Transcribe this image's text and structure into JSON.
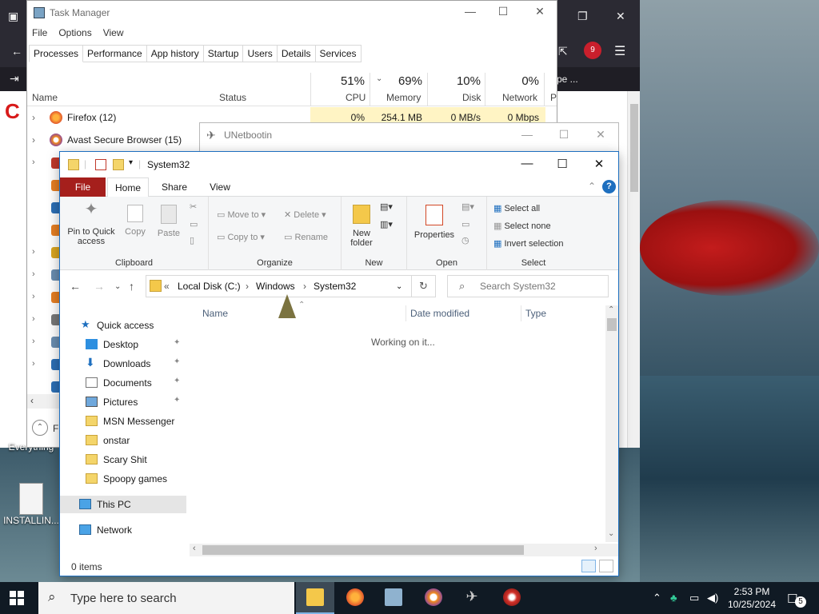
{
  "task_manager": {
    "title": "Task Manager",
    "menu": [
      "File",
      "Options",
      "View"
    ],
    "tabs": [
      "Processes",
      "Performance",
      "App history",
      "Startup",
      "Users",
      "Details",
      "Services"
    ],
    "columns": {
      "name": "Name",
      "status": "Status",
      "cpu": "CPU",
      "memory": "Memory",
      "disk": "Disk",
      "network": "Network",
      "power": "P"
    },
    "usage": {
      "cpu": "51%",
      "memory": "69%",
      "disk": "10%",
      "network": "0%"
    },
    "rows": [
      {
        "name": "Firefox (12)",
        "cpu": "0%",
        "memory": "254.1 MB",
        "disk": "0 MB/s",
        "network": "0 Mbps"
      },
      {
        "name": "Avast Secure Browser (15)"
      }
    ],
    "footer_label": "F"
  },
  "unetbootin": {
    "title": "UNetbootin"
  },
  "explorer": {
    "title": "System32",
    "ribbon_tabs": [
      "File",
      "Home",
      "Share",
      "View"
    ],
    "clipboard": {
      "pin": "Pin to Quick access",
      "copy": "Copy",
      "paste": "Paste",
      "label": "Clipboard"
    },
    "organize": {
      "move_to": "Move to",
      "copy_to": "Copy to",
      "delete": "Delete",
      "rename": "Rename",
      "label": "Organize"
    },
    "new": {
      "new_folder": "New folder",
      "label": "New"
    },
    "open": {
      "properties": "Properties",
      "label": "Open"
    },
    "select": {
      "select_all": "Select all",
      "select_none": "Select none",
      "invert": "Invert selection",
      "label": "Select"
    },
    "breadcrumb": [
      "«",
      "Local Disk (C:)",
      "Windows",
      "System32"
    ],
    "search_placeholder": "Search System32",
    "nav": {
      "quick_access": "Quick access",
      "items": [
        "Desktop",
        "Downloads",
        "Documents",
        "Pictures",
        "MSN Messenger",
        "onstar",
        "Scary Shit",
        "Spoopy games"
      ],
      "this_pc": "This PC",
      "network": "Network"
    },
    "columns": {
      "name": "Name",
      "date": "Date modified",
      "type": "Type"
    },
    "working": "Working on it...",
    "status": "0 items"
  },
  "desktop": {
    "icon1": "Everything",
    "icon2": "INSTALLIN..."
  },
  "browser": {
    "badge": "9",
    "tab_hint": "pe ..."
  },
  "taskbar": {
    "search_placeholder": "Type here to search",
    "time": "2:53 PM",
    "date": "10/25/2024",
    "notifications": "5"
  },
  "colors": {
    "accent": "#1e6fbf",
    "file_tab": "#a51f1c",
    "highlight": "#fff4c4"
  }
}
